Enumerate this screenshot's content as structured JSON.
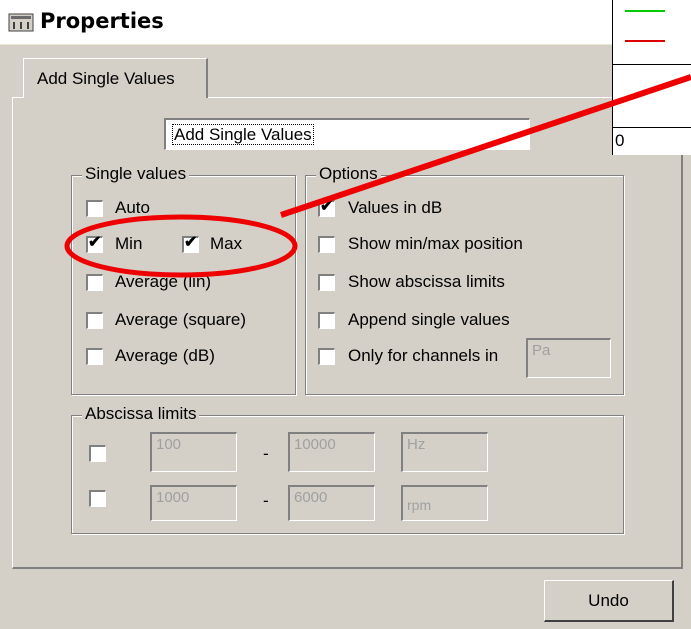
{
  "window": {
    "title": "Properties"
  },
  "tab": {
    "label": "Add Single Values"
  },
  "name_field": {
    "value": "Add Single Values"
  },
  "single_values": {
    "title": "Single values",
    "items": [
      {
        "label": "Auto",
        "checked": false
      },
      {
        "label": "Min",
        "checked": true
      },
      {
        "label": "Max",
        "checked": true
      },
      {
        "label": "Average (lin)",
        "checked": false
      },
      {
        "label": "Average (square)",
        "checked": false
      },
      {
        "label": "Average (dB)",
        "checked": false
      }
    ]
  },
  "options": {
    "title": "Options",
    "items": [
      {
        "label": "Values in dB",
        "checked": true
      },
      {
        "label": "Show min/max position",
        "checked": false
      },
      {
        "label": "Show abscissa limits",
        "checked": false
      },
      {
        "label": "Append single values",
        "checked": false
      },
      {
        "label": "Only for channels in",
        "checked": false
      }
    ],
    "channel_unit": "Pa"
  },
  "abscissa_limits": {
    "title": "Abscissa limits",
    "rows": [
      {
        "min": "100",
        "separator": "-",
        "max": "10000",
        "unit": "Hz"
      },
      {
        "min": "1000",
        "separator": "-",
        "max": "6000",
        "unit": "rpm"
      }
    ]
  },
  "buttons": {
    "undo": "Undo"
  },
  "legend": {
    "zero": "0",
    "colors": [
      "#00cc00",
      "#dd0000"
    ]
  },
  "annotation": {
    "color": "#ee0000"
  }
}
